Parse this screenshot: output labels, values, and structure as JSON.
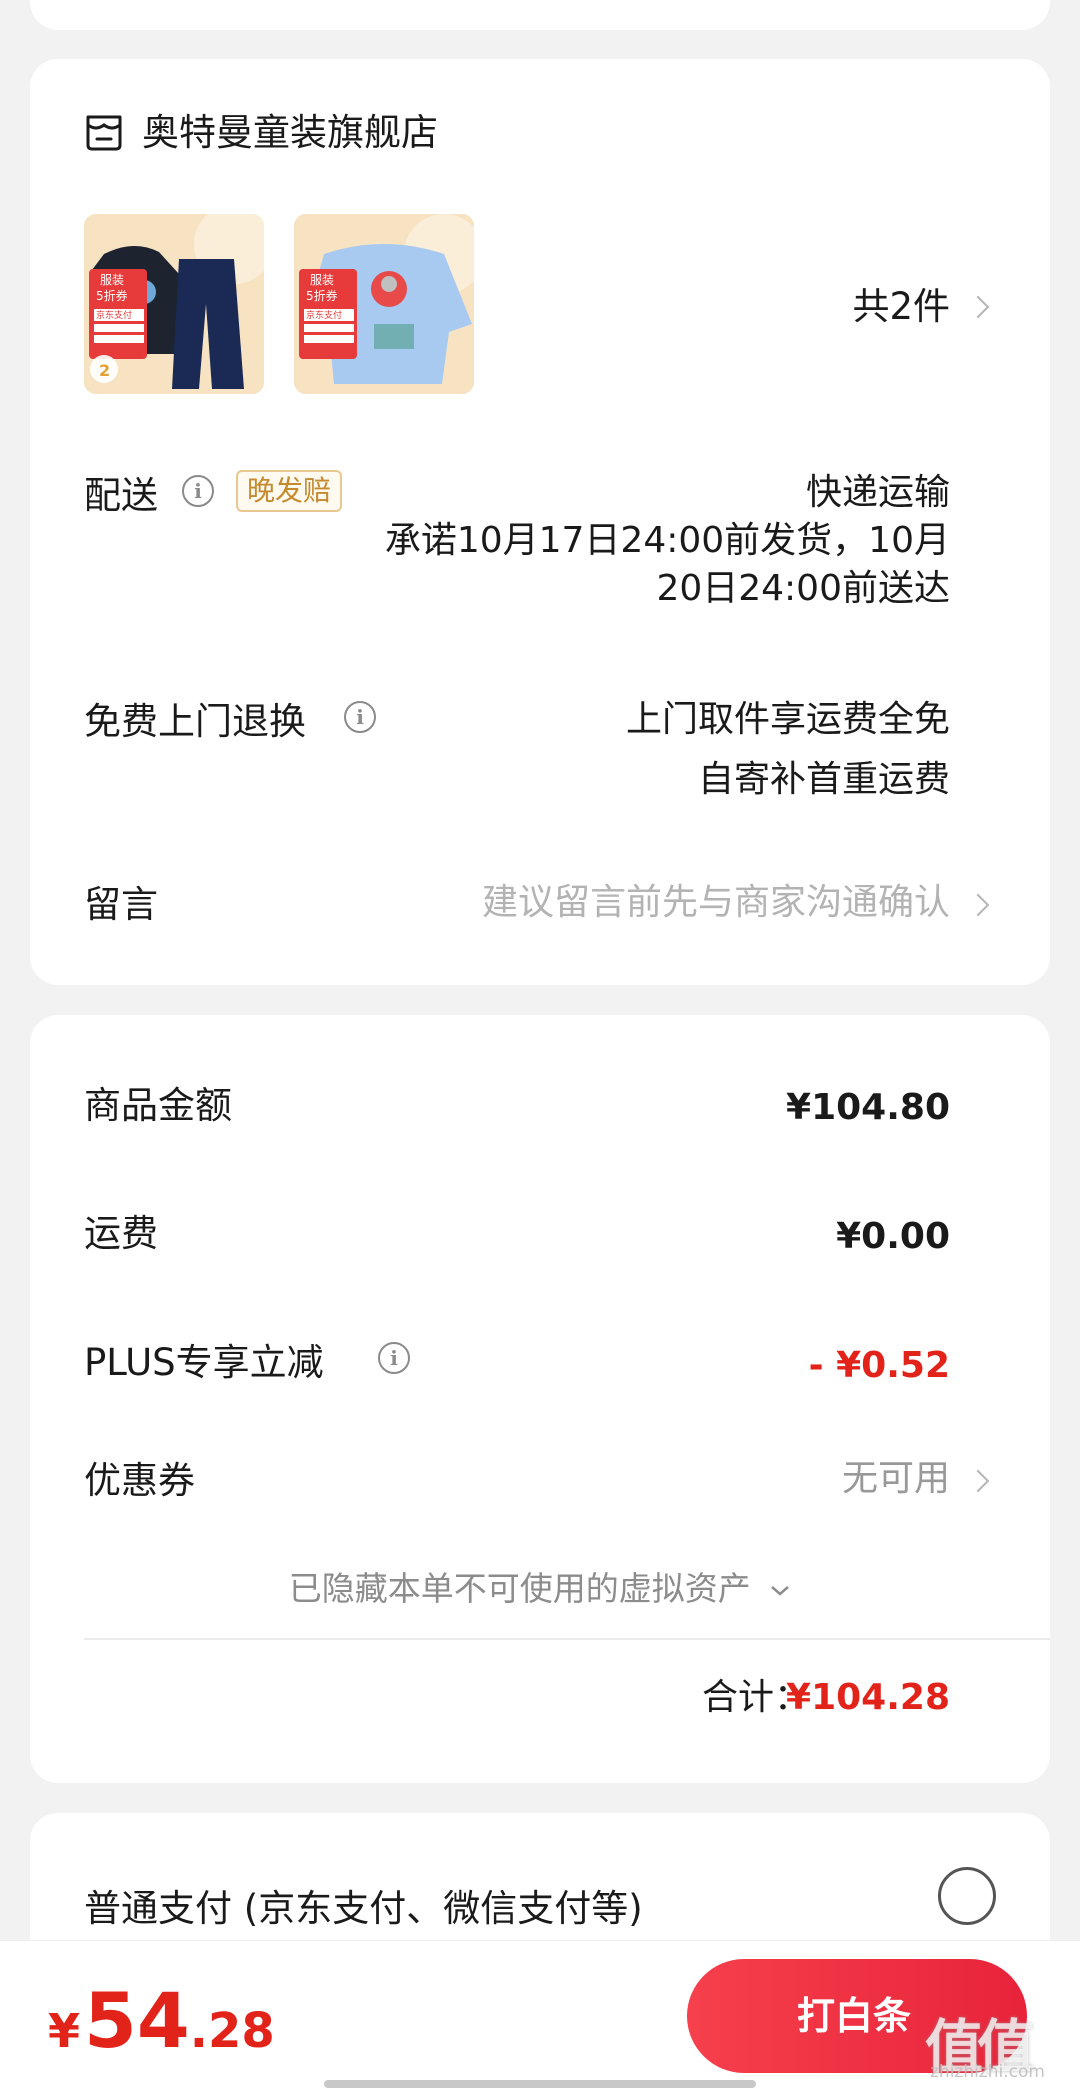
{
  "store": {
    "name": "奥特曼童装旗舰店",
    "item_count": "共2件",
    "products": [
      {
        "tag_top": "服装",
        "tag_mid": "5折券",
        "tag_pay": "京东支付"
      },
      {
        "tag_top": "服装",
        "tag_mid": "5折券",
        "tag_pay": "京东支付"
      }
    ]
  },
  "delivery": {
    "label": "配送",
    "badge": "晚发赔",
    "method": "快递运输",
    "promise_line1": "承诺10月17日24:00前发货，10月",
    "promise_line2": "20日24:00前送达"
  },
  "returns": {
    "label": "免费上门退换",
    "line1": "上门取件享运费全免",
    "line2": "自寄补首重运费"
  },
  "message": {
    "label": "留言",
    "placeholder": "建议留言前先与商家沟通确认"
  },
  "price": {
    "goods_label": "商品金额",
    "goods_value": "¥104.80",
    "shipping_label": "运费",
    "shipping_value": "¥0.00",
    "plus_label": "PLUS专享立减",
    "plus_value": "- ¥0.52",
    "coupon_label": "优惠券",
    "coupon_value": "无可用",
    "hidden_assets": "已隐藏本单不可使用的虚拟资产",
    "total_label": "合计：",
    "total_value": "¥104.28"
  },
  "payment": {
    "option_label": "普通支付 (京东支付、微信支付等)"
  },
  "bottom": {
    "currency": "¥",
    "amount_int": "54",
    "amount_dec": ".28",
    "button_label": "打白条"
  },
  "watermark": {
    "logo": "值值值",
    "url": "zhizhizhi.com"
  },
  "colors": {
    "accent_red": "#e2231a",
    "badge_gold": "#c58a2e",
    "button_gradient_start": "#f6404c",
    "button_gradient_end": "#e8233a"
  }
}
